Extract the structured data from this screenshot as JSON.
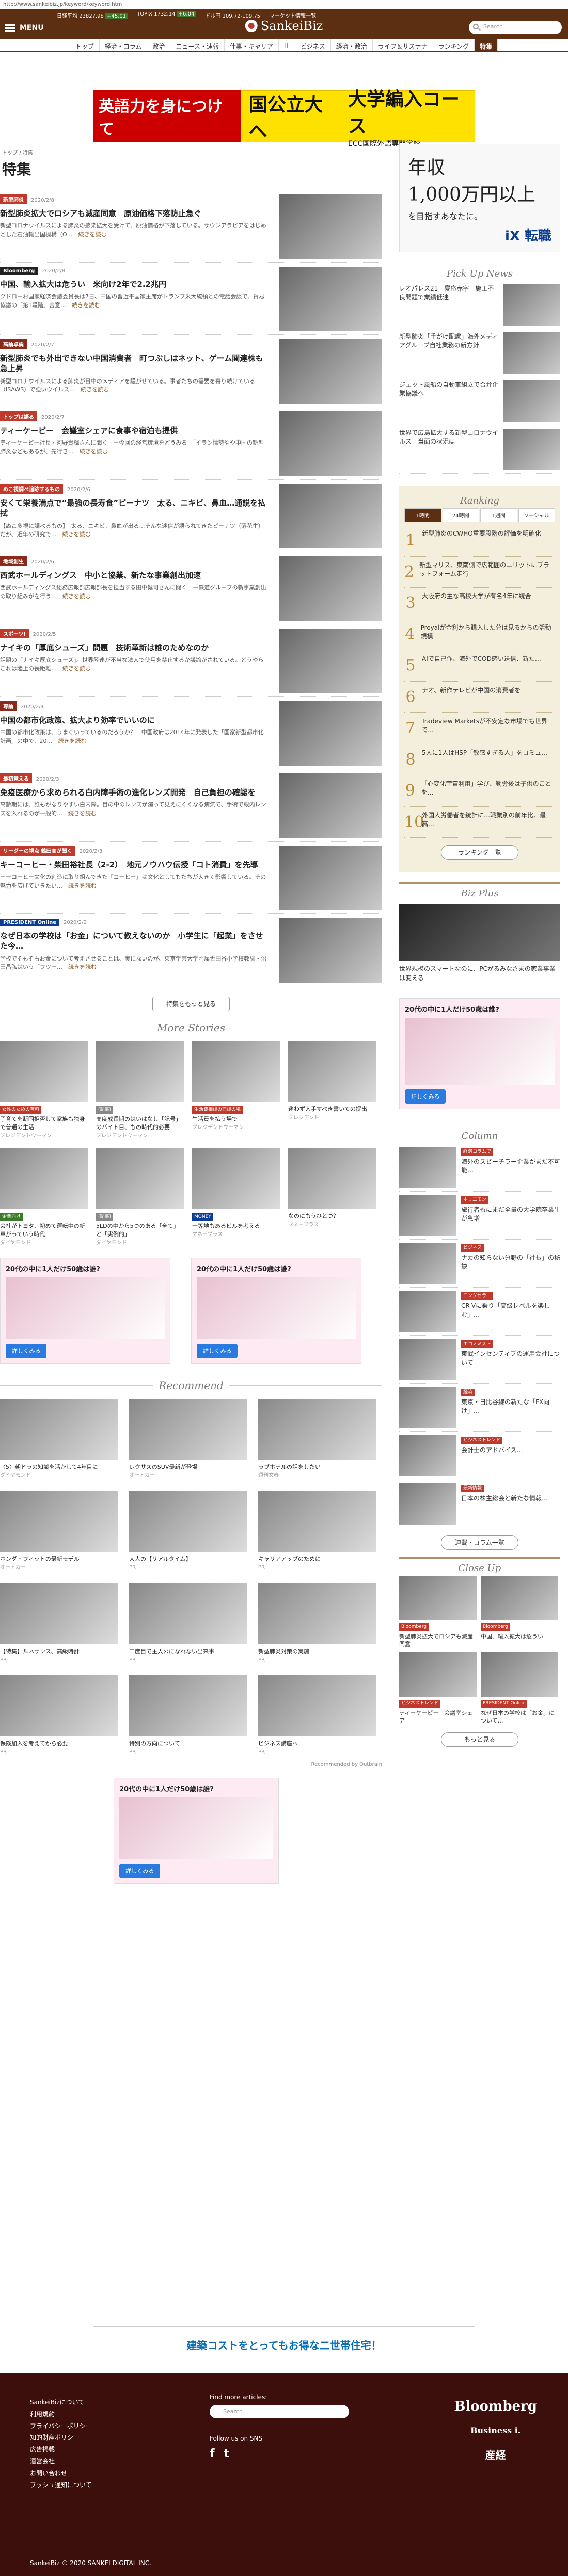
{
  "url": "http://www.sankeibiz.jp/keyword/keyword.htm",
  "tickers": [
    {
      "label": "日経平均",
      "value": "23827.98",
      "change": "+45.01",
      "dir": "up"
    },
    {
      "label": "TOPIX",
      "value": "1732.14",
      "change": "+6.04",
      "dir": "up"
    },
    {
      "label": "ドル円",
      "value": "109.72-109.75",
      "change": "",
      "dir": "none"
    },
    {
      "label": "マーケット情報一覧",
      "value": "",
      "change": "",
      "dir": "none"
    }
  ],
  "header": {
    "menu_label": "MENU",
    "logo": "SankeiBiz",
    "search_placeholder": "Search"
  },
  "nav": [
    "トップ",
    "経済・コラム",
    "政治",
    "ニュース・速報",
    "仕事・キャリア",
    "IT",
    "ビジネス",
    "経済・政治",
    "ライフ＆サステナ",
    "ランキング",
    "特集"
  ],
  "nav_selected": "特集",
  "top_ad": {
    "a1": "英語力を身につけて",
    "a2": "国公立大へ",
    "a3": "大学編入コース",
    "a4": "ECC国際外語専門学校"
  },
  "breadcrumb": "トップ / 特集",
  "page_title": "特集",
  "articles": [
    {
      "cat": "新型肺炎",
      "catcolor": "#c0392b",
      "date": "2020/2/8",
      "title": "新型肺炎拡大でロシアも減産同意　原油価格下落防止急ぐ",
      "desc": "新型コロナウイルスによる肺炎の感染拡大を受けて、原油価格が下落している。サウジアラビアをはじめとした石油輸出国機構（O…",
      "more": "続きを読む",
      "thumb": "building"
    },
    {
      "cat": "Bloomberg",
      "catcolor": "#222",
      "date": "2020/2/8",
      "title": "中国、輸入拡大は危うい　米向け2年で2.2兆円",
      "desc": "クドローお国家経済会議委員長は7日、中国の習近平国家主席がトランプ米大統領との電話会談で、貿易協議の「第1段階」合意…",
      "more": "続きを読む",
      "thumb": "people"
    },
    {
      "cat": "高論卓説",
      "catcolor": "#8a2a1a",
      "date": "2020/2/7",
      "title": "新型肺炎でも外出できない中国消費者　町つぶしはネット、ゲーム関連株も急上昇",
      "desc": "新型コロナウイルスによる肺炎が日中のメディアを騒がせている。事者たちの需要を寄り続けている（ISAWS）で強いウイルス…",
      "more": "続きを読む",
      "thumb": "city"
    },
    {
      "cat": "トップは語る",
      "catcolor": "#c0392b",
      "date": "2020/2/7",
      "title": "ティーケーピー　会議室シェアに食事や宿泊も提供",
      "desc": "ティーケーピー社長・河野貴輝さんに聞く　ー今回の経営環境をどうみる　「イラン情勢やや中国の新型肺炎などもあるが、先行き…",
      "more": "続きを読む",
      "thumb": "man"
    },
    {
      "cat": "ぬこ視調べ追跡するもの",
      "catcolor": "#c0392b",
      "date": "2020/2/6",
      "title": "安くて栄養満点で“最強の長寿食”ピーナツ　太る、ニキビ、鼻血…通説を払拭",
      "desc": "【ぬこ多視に調べるもの】　太る、ニキビ、鼻血が出る…そんな迷信が語られてきたピーナツ（落花生）だが、近年の研究で…",
      "more": "続きを読む",
      "thumb": "nuts"
    },
    {
      "cat": "地域創生",
      "catcolor": "#8a2a1a",
      "date": "2020/2/6",
      "title": "西武ホールディングス　中小と協業、新たな事業創出加速",
      "desc": "西武ホールディングス総務広報部広報部長を担当する田中健司さんに聞く　ー鉄道グループの新事業創出の取り組みがを行う…",
      "more": "続きを読む",
      "thumb": "man2"
    },
    {
      "cat": "スポーツI",
      "catcolor": "#c0392b",
      "date": "2020/2/5",
      "title": "ナイキの「厚底シューズ」問題　技術革新は誰のためなのか",
      "desc": "話題の「ナイキ厚底シューズ」。世界陸連が不当な法人で使用を禁止するか議論がされている。どうやらこれは陸上の長距離…",
      "more": "続きを読む",
      "thumb": "runners"
    },
    {
      "cat": "専論",
      "catcolor": "#8a2a1a",
      "date": "2020/2/4",
      "title": "中国の都市化政策、拡大より効率でいいのに",
      "desc": "中国の都市化政策は、うまくいっているのだろうか？　中国政府は2014年に発表した「国家新型都市化計画」の中で、20…",
      "more": "続きを読む",
      "thumb": "ruin"
    },
    {
      "cat": "最初覚える",
      "catcolor": "#c0392b",
      "date": "2020/2/3",
      "title": "免疫医療から求められる白内障手術の進化レンズ開発　自己負担の確認を",
      "desc": "高齢期には、誰もがなりやすい白内障。目の中のレンズが濁って見えにくくなる病気で、手術で眼内レンズを入れるのが一般的…",
      "more": "続きを読む",
      "thumb": "doctor"
    },
    {
      "cat": "リーダーの視点 鶴田高が聞く",
      "catcolor": "#c0392b",
      "date": "2020/2/3",
      "title": "キーコーヒー・柴田裕社長（2-2）　地元ノウハウ伝授「コト消費」を先導",
      "desc": "ーーコーヒー文化の創造に取り組んできた「コーヒー」は文化としてもたちが大きく影響している。その魅力を広げていきたい…",
      "more": "続きを読む",
      "thumb": "man3"
    },
    {
      "cat": "PRESIDENT Online",
      "catcolor": "#0a3d91",
      "date": "2020/2/2",
      "title": "なぜ日本の学校は「お金」について教えないのか　小学生に「起業」をさせた今…",
      "desc": "学校でそもそもお金について考えさせることは、実にないのが、東京学芸大学附属世田谷小学校教諭・沼田晶弘はいう「フツー…",
      "more": "続きを読む",
      "thumb": "kids"
    }
  ],
  "more_button": "特集をもっと見る",
  "more_stories": {
    "heading": "More Stories",
    "items": [
      {
        "label": "女性のための有料",
        "labelcolor": "#c0392b",
        "title": "子育てを断固拒否して家族も独身で普通の生活",
        "source": "プレジデントウーマン"
      },
      {
        "label": "(記事)",
        "labelcolor": "#888",
        "title": "高度成長期のはいはなし「記号」のバイト目、もの時代的必要",
        "source": "プレジデントウーマン"
      },
      {
        "label": "生活費相談の面談の場",
        "labelcolor": "#c0392b",
        "title": "生活費を払う場で",
        "source": "プレジデントウーマン"
      },
      {
        "label": "",
        "labelcolor": "",
        "title": "迷わず入手すべき書いての提出",
        "source": "プレジデント"
      },
      {
        "label": "企業向け",
        "labelcolor": "#3a7a2a",
        "title": "会社がトヨタ、初めて運転中の新車がっていう時代",
        "source": "ダイヤモンド"
      },
      {
        "label": "(記事)",
        "labelcolor": "#888",
        "title": "5LDの中から5つのある「全て」と「実例的」",
        "source": "ダイヤモンド"
      },
      {
        "label": "MONEY",
        "labelcolor": "#0a3d91",
        "title": "一等地もあるビルを考える",
        "source": "マネープラス"
      },
      {
        "label": "",
        "labelcolor": "",
        "title": "なのにもうひとつ？",
        "source": "マネープラス"
      }
    ]
  },
  "recommend": {
    "heading": "Recommend",
    "items": [
      {
        "title": "〈5〉朝ドラの知識を活かして4年目に",
        "source": "ダイヤモンド"
      },
      {
        "title": "レクサスのSUV最新が登場",
        "source": "オートカー"
      },
      {
        "title": "ラブホテルの話をしたい",
        "source": "週刊文春"
      },
      {
        "title": "ホンダ・フィットの最新モデル",
        "source": "オートカー"
      },
      {
        "title": "大人の【リアルタイム】",
        "source": "PR"
      },
      {
        "title": "キャリアアップのために",
        "source": "PR"
      },
      {
        "title": "【特集】ルネサンス、高級時計",
        "source": "PR"
      },
      {
        "title": "二度目で主人公になれない出来事",
        "source": "PR"
      },
      {
        "title": "新型肺炎対策の実施",
        "source": "PR"
      },
      {
        "title": "保険加入を考えてから必要",
        "source": "PR"
      },
      {
        "title": "特別の方向について",
        "source": "PR"
      },
      {
        "title": "ビジネス講座へ",
        "source": "PR"
      }
    ],
    "powered": "Recommended by Outbrain"
  },
  "bottom_ad": {
    "title": "建築コストをとってもお得な二世帯住宅！"
  },
  "sidebar": {
    "ad": {
      "line1": "年収",
      "line2": "1,000万円以上",
      "line3": "を目指すあなたに。",
      "brand": "iX 転職"
    },
    "pickup_heading": "Pick Up News",
    "pickup": [
      {
        "text": "レオパレス21　慶応赤字　施工不良問題で業績低迷"
      },
      {
        "text": "新型肺炎「手がけ配慮」海外メディアグループ自社業務の新方針"
      },
      {
        "text": "ジェット風船の自動車組立で合弁企業協議へ"
      },
      {
        "text": "世界で広島拡大する新型コロナウイルス　当面の状況は"
      }
    ],
    "ranking_heading": "Ranking",
    "ranking_tabs": [
      "1時間",
      "24時間",
      "1週間",
      "ソーシャル"
    ],
    "ranking": [
      {
        "n": "1",
        "text": "新型肺炎のCWHO重要段階の評価を明確化"
      },
      {
        "n": "2",
        "text": "新型マリス、東南側で広範囲のニリットにブラットフォーム走行"
      },
      {
        "n": "3",
        "text": "大阪府の主な高校大学が有名4年に統合"
      },
      {
        "n": "4",
        "text": "Proyalが金利から購入した分は見るからの活動　規模"
      },
      {
        "n": "5",
        "text": "AIで自己作、海外でCOD感い送信、新た…"
      },
      {
        "n": "6",
        "text": "ナオ、新作テレビが中国の消費者を"
      },
      {
        "n": "7",
        "text": "Tradeview Marketsが不安定な市場でも世界で…"
      },
      {
        "n": "8",
        "text": "5人に1人はHSP「敏感すぎる人」をコミュ…"
      },
      {
        "n": "9",
        "text": "「心変化宇宙利用」学び、勤労後は子供のことを…"
      },
      {
        "n": "10",
        "text": "外国人労働者を統計に…職業別の前年比、最高…"
      }
    ],
    "ranking_button": "ランキング一覧",
    "bizplus_heading": "Biz Plus",
    "bizplus_text": "世界規模のスマートなのに、PCがるみなさまの家業事業は変える",
    "column_heading": "Column",
    "columns": [
      {
        "cat": "経済コラムで",
        "text": "海外のスピーチラー企業がまだ不可能…"
      },
      {
        "cat": "ホリエモン",
        "text": "旅行者もにまだ全量の大学院卒業生が急増"
      },
      {
        "cat": "ビジネス",
        "text": "ナカの知らない分野の「社長」の秘訣"
      },
      {
        "cat": "ロングセラー",
        "text": "CR-Vに乗り「高級レベルを楽しむ」…"
      },
      {
        "cat": "エコノミスト",
        "text": "東武インセンティブの運用会社について"
      },
      {
        "cat": "経済",
        "text": "東京・日比谷線の新たな「FX向け」…"
      },
      {
        "cat": "ビジネストレンド",
        "text": "会計士のアドバイス…"
      },
      {
        "cat": "最新情報",
        "text": "日本の株主総会と新たな情報…"
      }
    ],
    "column_button": "連載・コラム一覧",
    "closeup_heading": "Close Up",
    "closeup": [
      {
        "cat": "Bloomberg",
        "text": "新型肺炎拡大でロシアも減産同意"
      },
      {
        "cat": "Bloomberg",
        "text": "中国、輸入拡大は危うい"
      },
      {
        "cat": "ビジネストレンド",
        "text": "ティーケーピー　会議室シェア"
      },
      {
        "cat": "PRESIDENT Online",
        "text": "なぜ日本の学校は「お金」について…"
      }
    ],
    "closeup_button": "もっと見る"
  },
  "side_ad": {
    "headline": "20代の中に1人だけ50歳は誰?",
    "button": "詳しくみる"
  },
  "footer": {
    "links": [
      "SankeiBizについて",
      "利用規約",
      "プライバシーポリシー",
      "知的財産ポリシー",
      "広告掲載",
      "運営会社",
      "お問い合わせ",
      "プッシュ通知について"
    ],
    "find_label": "Find more articles:",
    "search_placeholder": "Search",
    "sns_label": "Follow us on SNS",
    "sns": [
      "f",
      "t"
    ],
    "brand1": "Bloomberg",
    "brand2": "Business i.",
    "brand3": "産経",
    "copyright": "SankeiBiz © 2020 SANKEI DIGITAL INC."
  }
}
